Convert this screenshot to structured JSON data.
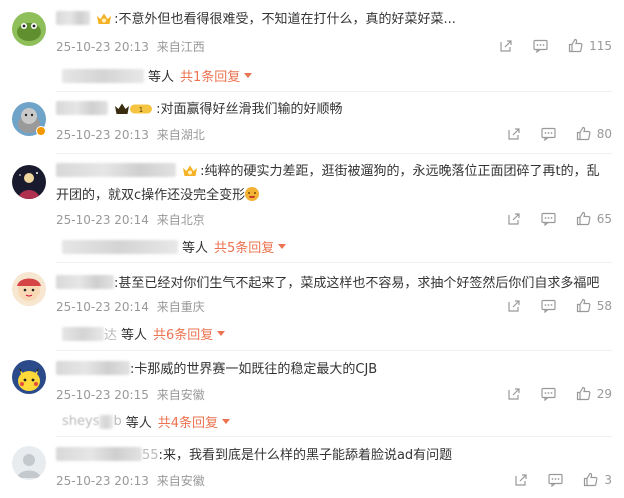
{
  "comments": [
    {
      "text": "不意外但也看得很难受，不知道在打什么，真的好菜好菜...",
      "time": "25-10-23 20:13",
      "location": "来自江西",
      "likes": "115",
      "reply_suffix": "等人",
      "reply_link": "共1条回复"
    },
    {
      "text": "对面赢得好丝滑我们输的好顺畅",
      "time": "25-10-23 20:13",
      "location": "来自湖北",
      "likes": "80"
    },
    {
      "text": "纯粹的硬实力差距，逛街被遛狗的，永远晚落位正面团碎了再t的，乱开团的，就双c操作还没完全变形",
      "time": "25-10-23 20:14",
      "location": "来自北京",
      "likes": "65",
      "reply_suffix": "等人",
      "reply_link": "共5条回复"
    },
    {
      "text": "甚至已经对你们生气不起来了，菜成这样也不容易，求抽个好签然后你们自求多福吧",
      "time": "25-10-23 20:14",
      "location": "来自重庆",
      "likes": "58",
      "reply_user_end": "达",
      "reply_suffix": "等人",
      "reply_link": "共6条回复"
    },
    {
      "text": "卡那威的世界赛一如既往的稳定最大的CJB",
      "time": "25-10-23 20:15",
      "location": "来自安徽",
      "likes": "29",
      "reply_user_fragment": "sheys",
      "reply_user_end": "b",
      "reply_suffix": "等人",
      "reply_link": "共4条回复"
    },
    {
      "user_end": "55",
      "text": "来，我看到底是什么样的黑子能舔着脸说ad有问题",
      "time": "25-10-23 20:13",
      "location": "来自安徽",
      "likes": "3"
    }
  ],
  "colors": {
    "accent": "#eb7350",
    "meta": "#999999",
    "text": "#333333"
  },
  "icons": {
    "share": "share-icon",
    "comment": "comment-icon",
    "like": "thumbs-up-icon"
  }
}
